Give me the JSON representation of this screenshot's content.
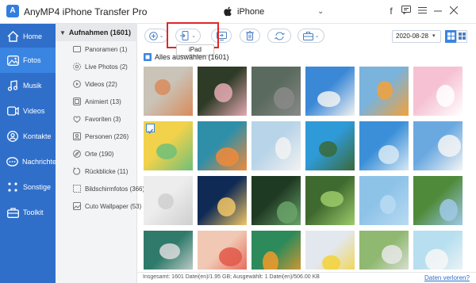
{
  "app": {
    "title": "AnyMP4 iPhone Transfer Pro",
    "logo_letter": "A",
    "device": "iPhone",
    "device_chevron": "⌄"
  },
  "window_controls": [
    "f",
    "☖",
    "☰",
    "—",
    "✕"
  ],
  "sidebar": {
    "items": [
      {
        "label": "Home",
        "icon": "home-icon",
        "active": false
      },
      {
        "label": "Fotos",
        "icon": "photos-icon",
        "active": true
      },
      {
        "label": "Musik",
        "icon": "music-icon",
        "active": false
      },
      {
        "label": "Videos",
        "icon": "video-icon",
        "active": false
      },
      {
        "label": "Kontakte",
        "icon": "contacts-icon",
        "active": false
      },
      {
        "label": "Nachrichten",
        "icon": "messages-icon",
        "active": false
      },
      {
        "label": "Sonstige",
        "icon": "other-icon",
        "active": false
      },
      {
        "label": "Toolkit",
        "icon": "toolkit-icon",
        "active": false
      }
    ]
  },
  "categories": {
    "caret": "▼",
    "header": "Aufnahmen (1601)",
    "items": [
      {
        "label": "Panoramen (1)",
        "icon": "panorama-icon"
      },
      {
        "label": "Live Photos (2)",
        "icon": "live-photo-icon"
      },
      {
        "label": "Videos (22)",
        "icon": "video-icon"
      },
      {
        "label": "Animiert (13)",
        "icon": "animated-icon"
      },
      {
        "label": "Favoriten (3)",
        "icon": "heart-icon"
      },
      {
        "label": "Personen (226)",
        "icon": "person-icon"
      },
      {
        "label": "Orte (190)",
        "icon": "location-icon"
      },
      {
        "label": "Rückblicke (11)",
        "icon": "memories-icon"
      },
      {
        "label": "Bildschirmfotos (366)",
        "icon": "screenshot-icon"
      },
      {
        "label": "Cuto Wallpaper (53)",
        "icon": "wallpaper-icon"
      }
    ]
  },
  "toolbar": {
    "chevron": "⌄",
    "buttons": [
      {
        "name": "add-button",
        "icon": "plus-icon"
      },
      {
        "name": "export-to-device-button",
        "icon": "export-device-icon"
      },
      {
        "name": "export-to-pc-button",
        "icon": "export-pc-icon"
      },
      {
        "name": "delete-button",
        "icon": "trash-icon"
      },
      {
        "name": "refresh-button",
        "icon": "refresh-icon"
      },
      {
        "name": "toolbox-button",
        "icon": "toolbox-icon"
      }
    ],
    "export_menu_item": "iPad",
    "date": "2020-08-28",
    "date_chevron": "▾",
    "views": [
      "grid-view",
      "list-view"
    ]
  },
  "select_all": {
    "label": "Alles auswählen (1601)",
    "checked": true
  },
  "photos": [
    {
      "subject": "basketball hoop",
      "checked": false,
      "colors": [
        "#c9c3b8",
        "#d98b5a"
      ]
    },
    {
      "subject": "flowers",
      "checked": false,
      "colors": [
        "#2e3b26",
        "#e4aab3"
      ]
    },
    {
      "subject": "cat",
      "checked": false,
      "colors": [
        "#5a6a5e",
        "#8a8a88"
      ]
    },
    {
      "subject": "tower",
      "checked": false,
      "colors": [
        "#3a88d6",
        "#f2f2f2"
      ]
    },
    {
      "subject": "orange juice",
      "checked": false,
      "colors": [
        "#7ab3dc",
        "#f3a13a"
      ]
    },
    {
      "subject": "egg",
      "checked": false,
      "colors": [
        "#f6c2d3",
        "#ffffff"
      ]
    },
    {
      "subject": "citrus pattern",
      "checked": true,
      "colors": [
        "#f2d24a",
        "#6fbf7a"
      ]
    },
    {
      "subject": "fruit on blue",
      "checked": false,
      "colors": [
        "#2f8fa8",
        "#f08a3a"
      ]
    },
    {
      "subject": "food plates",
      "checked": false,
      "colors": [
        "#b8d4e8",
        "#f2f2f2"
      ]
    },
    {
      "subject": "palm tree",
      "checked": false,
      "colors": [
        "#2f9ad8",
        "#3a6a3a"
      ]
    },
    {
      "subject": "glass bottle",
      "checked": false,
      "colors": [
        "#3a8fd8",
        "#d7e9f5"
      ]
    },
    {
      "subject": "white blossoms",
      "checked": false,
      "colors": [
        "#6aa9e0",
        "#f5f5f5"
      ]
    },
    {
      "subject": "white flowers",
      "checked": false,
      "colors": [
        "#ededed",
        "#cfcfcf"
      ]
    },
    {
      "subject": "city night",
      "checked": false,
      "colors": [
        "#0f2a55",
        "#f1c766"
      ]
    },
    {
      "subject": "tree avenue",
      "checked": false,
      "colors": [
        "#1f3a22",
        "#6aa36a"
      ]
    },
    {
      "subject": "green leaf",
      "checked": false,
      "colors": [
        "#3f6a2f",
        "#9ccb6a"
      ]
    },
    {
      "subject": "sky bird",
      "checked": false,
      "colors": [
        "#8ec3e8",
        "#b9dbf2"
      ]
    },
    {
      "subject": "green field",
      "checked": false,
      "colors": [
        "#4f8a3a",
        "#9fc9e8"
      ]
    },
    {
      "subject": "watch",
      "checked": false,
      "colors": [
        "#2f7a6a",
        "#dcdcdc"
      ]
    },
    {
      "subject": "grapefruit",
      "checked": false,
      "colors": [
        "#f1c8b3",
        "#e2584a"
      ]
    },
    {
      "subject": "orange on green",
      "checked": false,
      "colors": [
        "#2d8a5a",
        "#f29a2a"
      ]
    },
    {
      "subject": "lemon",
      "checked": false,
      "colors": [
        "#e3e8ef",
        "#f3d23a"
      ]
    },
    {
      "subject": "dandelion field",
      "checked": false,
      "colors": [
        "#8fb870",
        "#e8e8e8"
      ]
    },
    {
      "subject": "white flower",
      "checked": false,
      "colors": [
        "#b7dff0",
        "#f7f7f7"
      ]
    }
  ],
  "status": {
    "text": "Insgesamt: 1601 Datei(en)/1.95 GB; Ausgewählt: 1 Datei(en)/506.00 KB",
    "link": "Daten verloren?"
  },
  "colors": {
    "sidebar": "#2f6fca",
    "sidebar_active": "#3a85e2",
    "accent": "#3a85e2",
    "highlight": "#e0262a"
  }
}
